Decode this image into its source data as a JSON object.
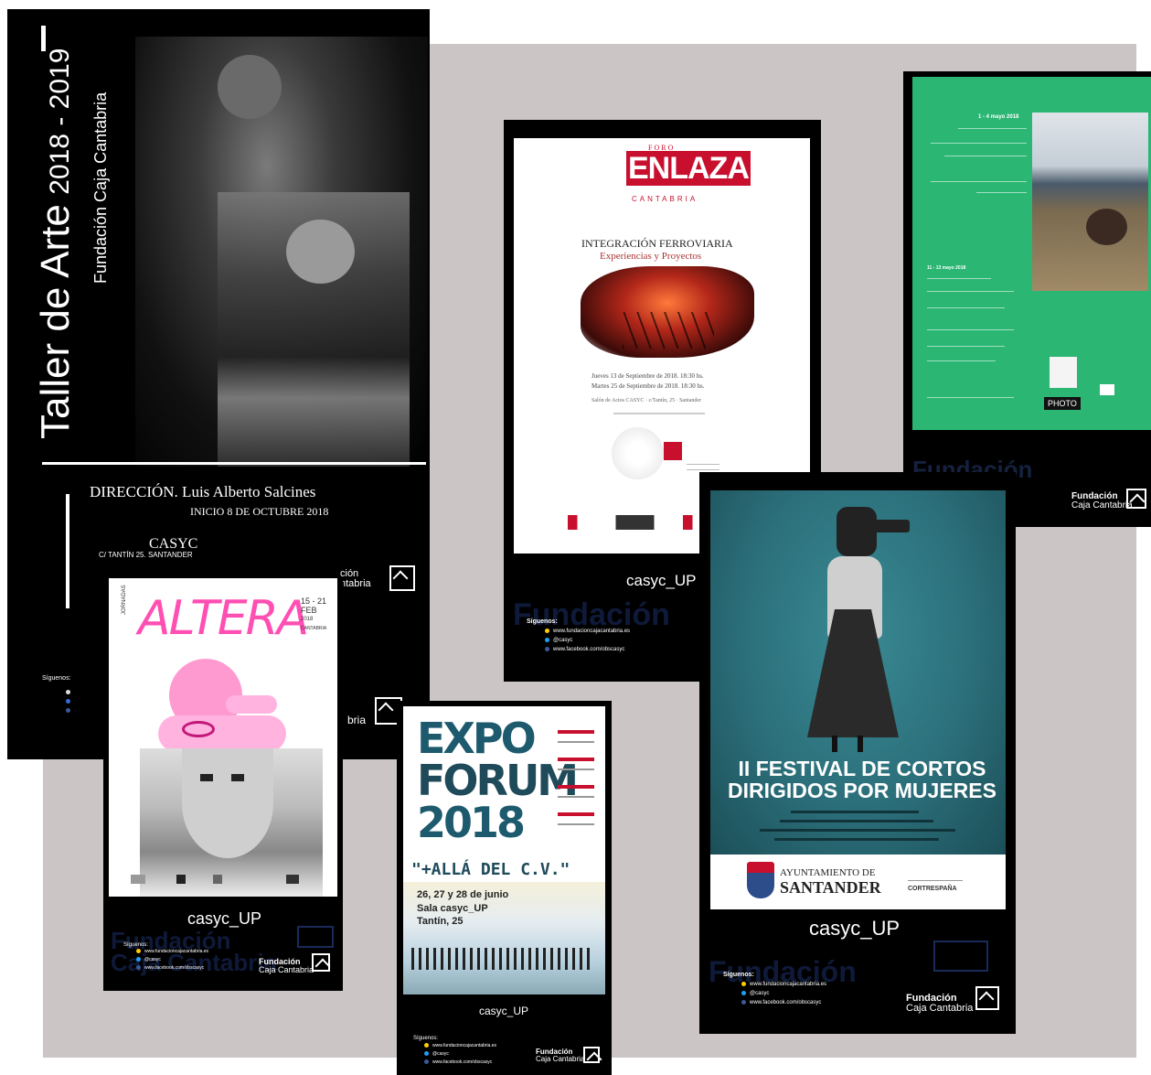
{
  "poster_taller": {
    "title": "Taller de Arte",
    "years": "2018 - 2019",
    "org": "Fundación Caja Cantabria",
    "direction": "DIRECCIÓN. Luis Alberto Salcines",
    "start": "INICIO 8 DE OCTUBRE 2018",
    "venue": "CASYC",
    "venue_address": "C/ TANTÍN 25. SANTANDER",
    "ghost_brand": "ción",
    "ghost_brand2": "ntabria",
    "follow": "Síguenos:",
    "ghost_bottom": "bria"
  },
  "poster_enlaza": {
    "brand_top": "FORO",
    "brand": "ENLAZA",
    "brand_bottom": "CANTABRIA",
    "title": "INTEGRACIÓN FERROVIARIA",
    "subtitle": "Experiencias y Proyectos",
    "date1": "Jueves 13 de Septiembre de 2018. 18:30 hs.",
    "date2": "Martes 25 de Septiembre de 2018. 18:30 hs.",
    "venue": "Salón de Actos CASYC · c/Tantín, 25 · Santander",
    "casyc": "casyc_UP",
    "follow": "Síguenos:",
    "web": "www.fundacioncajacantabria.es",
    "twitter": "@casyc",
    "facebook": "www.facebook.com/obscasyc",
    "ghost": "Fundación"
  },
  "poster_green": {
    "date1": "1 - 4 mayo 2018",
    "date2": "11 - 13 mayo 2018",
    "fcc_line1": "Fundación",
    "fcc_line2": "Caja Cantabria",
    "photo_label": "PHOTO",
    "accent": "#2bb673"
  },
  "poster_altera": {
    "side": "JORNADAS",
    "title": "ALTERA",
    "dates": "15 - 21 FEB",
    "year": "2018",
    "place": "CANTABRIA",
    "casyc": "casyc_UP",
    "follow": "Síguenos:",
    "web": "www.fundacioncajacantabria.es",
    "twitter": "@casyc",
    "facebook": "www.facebook.com/obscasyc",
    "fcc_line1": "Fundación",
    "fcc_line2": "Caja Cantabria",
    "ghost": "Fundación",
    "ghost2": "Caja Cantabria",
    "accent": "#ff4fb3"
  },
  "poster_expo": {
    "title1": "EXPO",
    "title2": "FORUM",
    "title3": "2018",
    "subtitle": "\"+ALLÁ DEL C.V.\"",
    "dates": "26, 27 y 28 de junio",
    "venue": "Sala casyc_UP",
    "address": "Tantín, 25",
    "casyc": "casyc_UP",
    "follow": "Síguenos:",
    "web": "www.fundacioncajacantabria.es",
    "twitter": "@casyc",
    "facebook": "www.facebook.com/obscasyc",
    "fcc_line1": "Fundación",
    "fcc_line2": "Caja Cantabria",
    "accent": "#1e5a6e"
  },
  "poster_festival": {
    "title1": "II FESTIVAL DE CORTOS",
    "title2": "DIRIGIDOS POR MUJERES",
    "sponsor1_line1": "AYUNTAMIENTO DE",
    "sponsor1_line2": "SANTANDER",
    "sponsor2": "CORTRESPAÑA",
    "casyc": "casyc_UP",
    "follow": "Síguenos:",
    "web": "www.fundacioncajacantabria.es",
    "twitter": "@casyc",
    "facebook": "www.facebook.com/obscasyc",
    "fcc_line1": "Fundación",
    "fcc_line2": "Caja Cantabria",
    "ghost": "Fundación",
    "accent": "#2b6f7a"
  }
}
